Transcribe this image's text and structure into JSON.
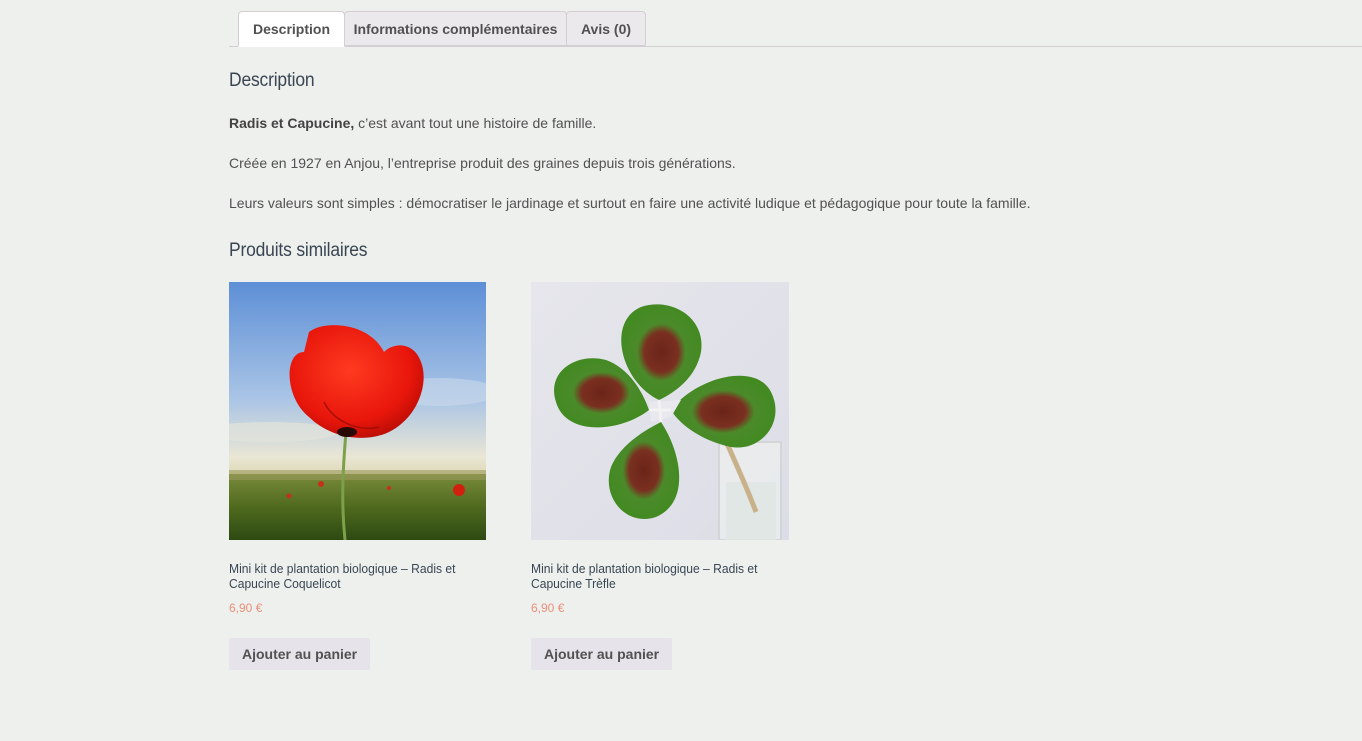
{
  "tabs": {
    "description": "Description",
    "additional_info": "Informations complémentaires",
    "reviews": "Avis (0)"
  },
  "description": {
    "heading": "Description",
    "para1_bold": "Radis et Capucine,",
    "para1_rest": " c’est avant tout une histoire de famille.",
    "para2": "Créée en 1927 en Anjou, l’entreprise produit des graines depuis trois générations.",
    "para3": "Leurs valeurs sont simples : démocratiser le jardinage et surtout en faire une activité ludique et pédagogique pour toute la famille."
  },
  "related": {
    "heading": "Produits similaires",
    "products": [
      {
        "title": "Mini kit de plantation biologique – Radis et Capucine Coquelicot",
        "price": "6,90 €",
        "button": "Ajouter au panier",
        "image": "poppy-flower-photo"
      },
      {
        "title": "Mini kit de plantation biologique – Radis et Capucine Trèfle",
        "price": "6,90 €",
        "button": "Ajouter au panier",
        "image": "four-leaf-clover-photo"
      }
    ]
  },
  "colors": {
    "background": "#edf0ec",
    "heading": "#3a4654",
    "price": "#e98f7a",
    "button_bg": "#e6e3ea"
  }
}
